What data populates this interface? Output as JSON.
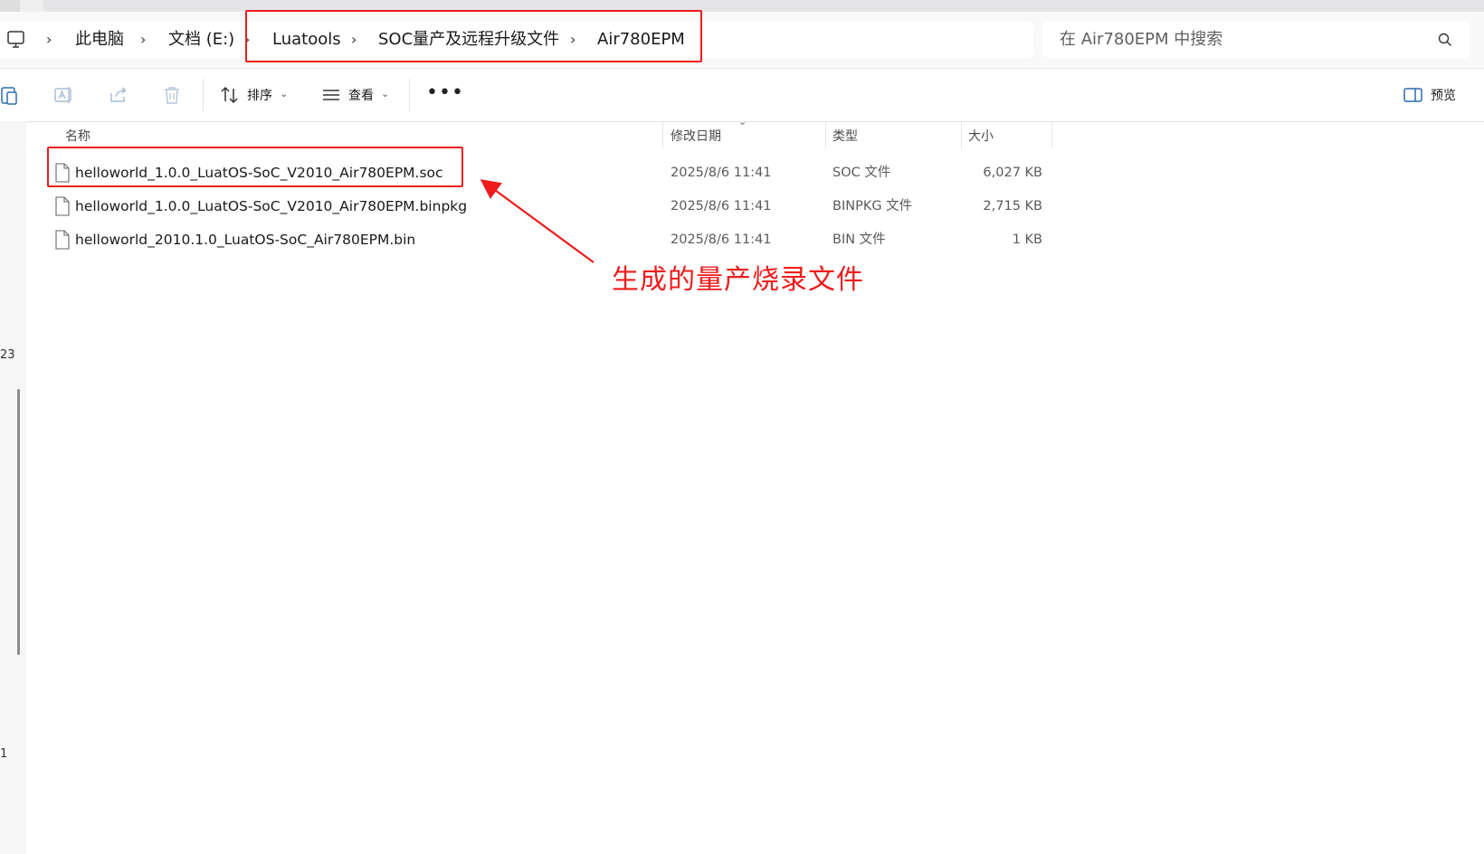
{
  "address_bar": {
    "breadcrumbs": [
      "此电脑",
      "文档 (E:)",
      "Luatools",
      "SOC量产及远程升级文件",
      "Air780EPM"
    ],
    "search_placeholder": "在 Air780EPM 中搜索"
  },
  "toolbar": {
    "sort_label": "排序",
    "view_label": "查看",
    "preview_label": "预览"
  },
  "columns": {
    "name": "名称",
    "modified": "修改日期",
    "type": "类型",
    "size": "大小"
  },
  "files": [
    {
      "name": "helloworld_1.0.0_LuatOS-SoC_V2010_Air780EPM.soc",
      "modified": "2025/8/6 11:41",
      "type": "SOC 文件",
      "size": "6,027 KB"
    },
    {
      "name": "helloworld_1.0.0_LuatOS-SoC_V2010_Air780EPM.binpkg",
      "modified": "2025/8/6 11:41",
      "type": "BINPKG 文件",
      "size": "2,715 KB"
    },
    {
      "name": "helloworld_2010.1.0_LuatOS-SoC_Air780EPM.bin",
      "modified": "2025/8/6 11:41",
      "type": "BIN 文件",
      "size": "1 KB"
    }
  ],
  "nav_fragments": [
    "23",
    "1"
  ],
  "annotation": {
    "text": "生成的量产烧录文件",
    "color": "#ee1c1c"
  },
  "icons": [
    "computer-icon",
    "paste-icon",
    "rename-icon",
    "share-icon",
    "delete-icon",
    "sort-icon",
    "view-icon",
    "more-icon",
    "preview-pane-icon",
    "search-icon",
    "file-icon"
  ]
}
